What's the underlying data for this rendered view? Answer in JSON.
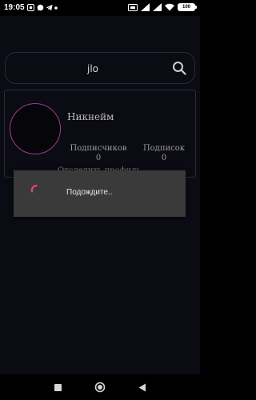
{
  "status_bar": {
    "time": "19:05",
    "battery": "100"
  },
  "search": {
    "value": "jlo"
  },
  "profile": {
    "nickname": "Никнейм",
    "followers_label": "Подписчиков",
    "followers_count": "0",
    "following_label": "Подписок",
    "following_count": "0",
    "obscured_text": "Отследить профиль"
  },
  "dialog": {
    "message": "Подождите.."
  },
  "colors": {
    "background": "#0b0b14",
    "avatar_ring": "#a33a8c",
    "spinner": "#e8457a",
    "dialog_bg": "#3a3a3a"
  },
  "icons": {
    "search": "search-icon",
    "recent_apps": "square-icon",
    "home": "circle-icon",
    "back": "triangle-back-icon"
  }
}
